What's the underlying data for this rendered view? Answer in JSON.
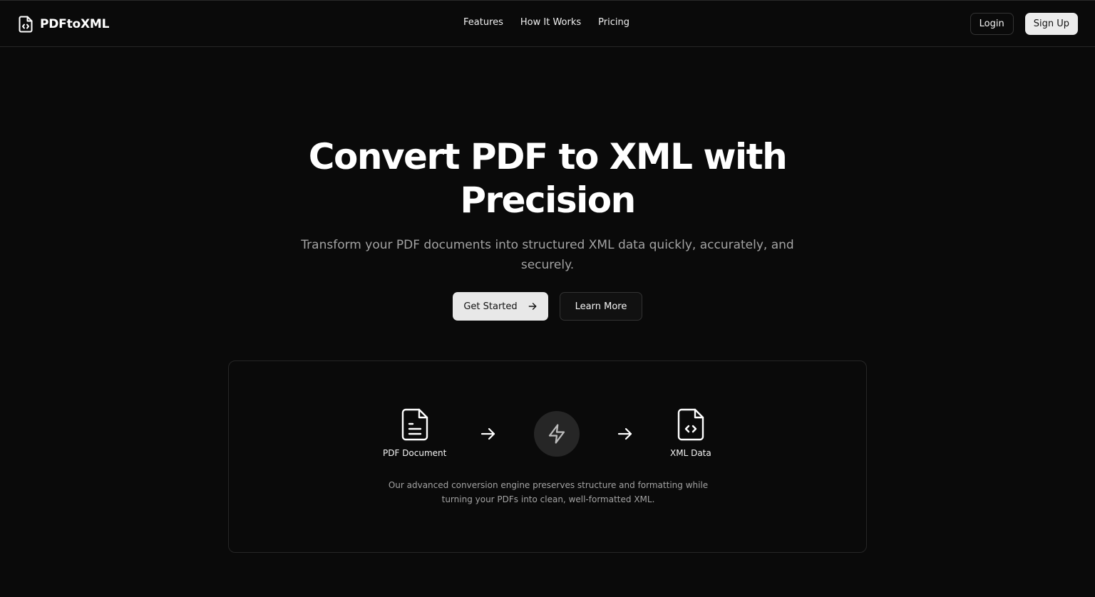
{
  "brand": {
    "name": "PDFtoXML",
    "icon": "file-code-icon"
  },
  "nav": {
    "items": [
      "Features",
      "How It Works",
      "Pricing"
    ]
  },
  "auth": {
    "login": "Login",
    "signup": "Sign Up"
  },
  "hero": {
    "title_line1": "Convert PDF to XML with",
    "title_line2": "Precision",
    "subtitle": "Transform your PDF documents into structured XML data quickly, accurately, and securely.",
    "cta_primary": "Get Started",
    "cta_secondary": "Learn More"
  },
  "flow": {
    "source_label": "PDF Document",
    "source_icon": "file-text-icon",
    "engine_icon": "zap-icon",
    "target_label": "XML Data",
    "target_icon": "file-code-icon",
    "description": "Our advanced conversion engine preserves structure and formatting while turning your PDFs into clean, well-formatted XML."
  },
  "colors": {
    "background": "#0a0a0a",
    "border": "#262626",
    "primary_button": "#e8e8e8",
    "muted_text": "#a3a3a3"
  }
}
